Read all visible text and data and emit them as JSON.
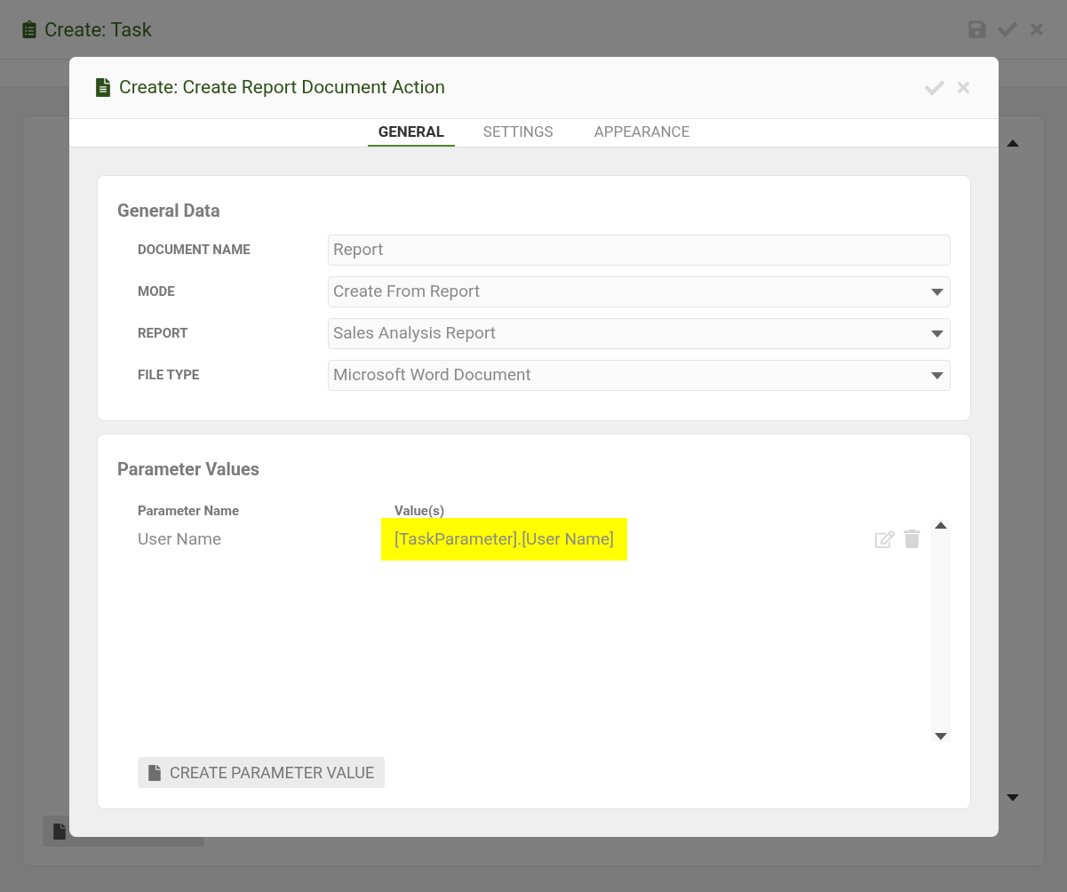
{
  "page": {
    "title": "Create: Task"
  },
  "dialog": {
    "title": "Create: Create Report Document Action",
    "tabs": [
      {
        "label": "GENERAL",
        "selected": true
      },
      {
        "label": "SETTINGS",
        "selected": false
      },
      {
        "label": "APPEARANCE",
        "selected": false
      }
    ],
    "general_data": {
      "title": "General Data",
      "fields": [
        {
          "label": "DOCUMENT NAME",
          "value": "Report",
          "kind": "text"
        },
        {
          "label": "MODE",
          "value": "Create From Report",
          "kind": "select"
        },
        {
          "label": "REPORT",
          "value": "Sales Analysis Report",
          "kind": "select"
        },
        {
          "label": "FILE TYPE",
          "value": "Microsoft Word Document",
          "kind": "select"
        }
      ]
    },
    "parameter_values": {
      "title": "Parameter Values",
      "columns": [
        "Parameter Name",
        "Value(s)"
      ],
      "rows": [
        {
          "name": "User Name",
          "value": "[TaskParameter].[User Name]",
          "selected": true
        }
      ],
      "button": "CREATE PARAMETER VALUE"
    }
  }
}
